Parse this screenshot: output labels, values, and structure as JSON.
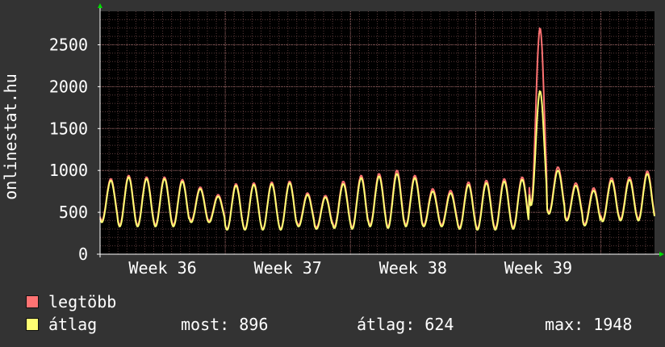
{
  "chart_data": {
    "type": "line",
    "ylabel": "onlinestat.hu",
    "ylim": [
      0,
      2900
    ],
    "yticks": [
      0,
      500,
      1000,
      1500,
      2000,
      2500
    ],
    "xticks": [
      {
        "label": "Week 36",
        "day": 3.5
      },
      {
        "label": "Week 37",
        "day": 10.5
      },
      {
        "label": "Week 38",
        "day": 17.5
      },
      {
        "label": "Week 39",
        "day": 24.5
      }
    ],
    "x_range_days": [
      0,
      31
    ],
    "grid": true,
    "legend_placement": "bottom-left",
    "series": [
      {
        "name": "legtöbb",
        "color": "#ff7373",
        "daily_max": [
          900,
          940,
          920,
          920,
          890,
          800,
          710,
          840,
          850,
          860,
          870,
          730,
          700,
          870,
          940,
          960,
          1000,
          940,
          780,
          760,
          860,
          880,
          900,
          920,
          2700,
          1040,
          850,
          790,
          910,
          920,
          990
        ],
        "daily_min": [
          400,
          350,
          350,
          350,
          350,
          400,
          400,
          300,
          300,
          300,
          300,
          350,
          320,
          330,
          320,
          350,
          330,
          350,
          350,
          350,
          320,
          310,
          310,
          320,
          600,
          500,
          420,
          360,
          410,
          420,
          420
        ]
      },
      {
        "name": "átlag",
        "color": "#ffff73",
        "daily_max": [
          880,
          920,
          900,
          900,
          870,
          780,
          690,
          820,
          830,
          840,
          850,
          710,
          680,
          840,
          910,
          930,
          960,
          910,
          750,
          730,
          830,
          850,
          870,
          890,
          1948,
          1000,
          820,
          760,
          880,
          890,
          960
        ],
        "daily_min": [
          380,
          330,
          330,
          330,
          330,
          380,
          380,
          290,
          290,
          290,
          290,
          330,
          300,
          310,
          300,
          330,
          310,
          330,
          330,
          330,
          300,
          290,
          290,
          300,
          580,
          480,
          400,
          340,
          390,
          400,
          400
        ]
      }
    ]
  },
  "legend": {
    "max_label": "legtöbb",
    "avg_label": "átlag"
  },
  "stats": {
    "current": "most: 896",
    "average": "átlag: 624",
    "maximum": "max: 1948"
  },
  "colors": {
    "background": "#333333",
    "plot_background": "#000000",
    "grid": "#c08080",
    "max_series": "#ff7373",
    "avg_series": "#ffff73",
    "arrow": "#00dd00"
  }
}
